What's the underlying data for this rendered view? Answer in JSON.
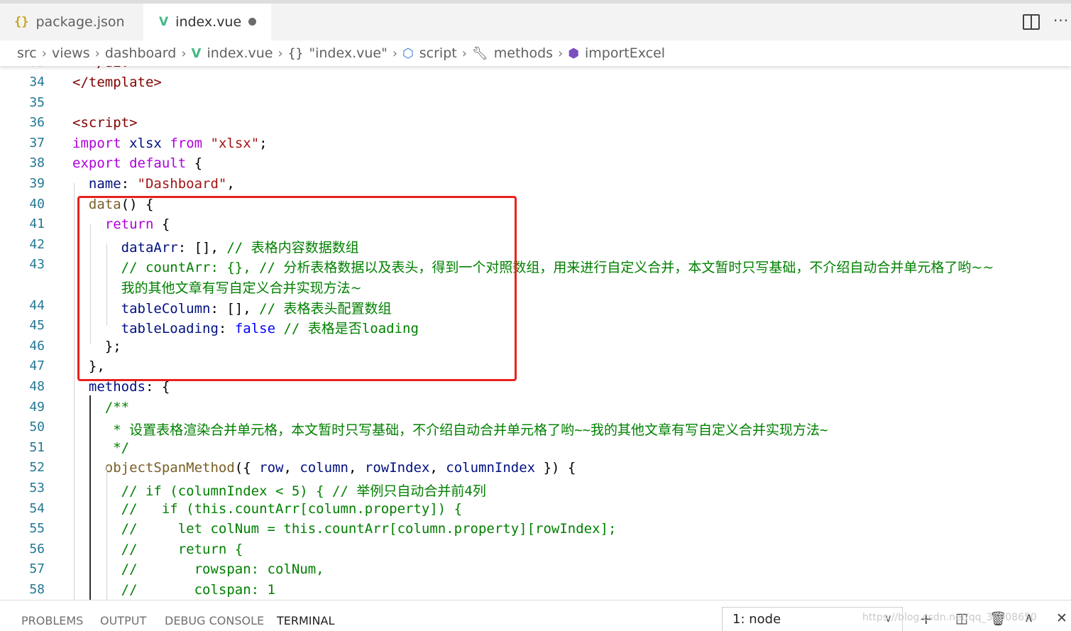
{
  "tabs": [
    {
      "label": "package.json",
      "icon": "json-braces-icon",
      "active": false
    },
    {
      "label": "index.vue",
      "icon": "vue-logo-icon",
      "active": true,
      "dirty": true
    }
  ],
  "breadcrumb": [
    "src",
    "views",
    "dashboard",
    "index.vue",
    "\"index.vue\"",
    "script",
    "methods",
    "importExcel"
  ],
  "editor": {
    "lines": [
      {
        "n": "34",
        "html": "<span class='t-tag'>&lt;/template&gt;</span>"
      },
      {
        "n": "35",
        "html": ""
      },
      {
        "n": "36",
        "html": "<span class='t-tag'>&lt;script&gt;</span>"
      },
      {
        "n": "37",
        "html": "<span class='t-kw'>import</span> <span class='t-prop'>xlsx</span> <span class='t-kw'>from</span> <span class='t-str'>\"xlsx\"</span>;"
      },
      {
        "n": "38",
        "html": "<span class='t-kw'>export</span> <span class='t-kw'>default</span> {"
      },
      {
        "n": "39",
        "html": "  <span class='t-prop'>name</span>: <span class='t-str'>\"Dashboard\"</span>,"
      },
      {
        "n": "40",
        "html": "  <span class='t-fn'>data</span>() {"
      },
      {
        "n": "41",
        "html": "    <span class='t-kw'>return</span> {"
      },
      {
        "n": "42",
        "html": "      <span class='t-prop'>dataArr</span>: [], <span class='t-cm'>// <span class='cjk'>表格内容数据数组</span></span>"
      },
      {
        "n": "43",
        "html": "      <span class='t-cm'>// countArr: {}, // <span class='cjk'>分析表格数据以及表头，得到一个对照数组，用来进行自定义合并，本文暂时只写基础，不介绍自动合并单元格了哟~~</span></span>"
      },
      {
        "n": "",
        "html": "      <span class='t-cm'><span class='cjk'>我的其他文章有写自定义合并实现方法~</span></span>"
      },
      {
        "n": "44",
        "html": "      <span class='t-prop'>tableColumn</span>: [], <span class='t-cm'>// <span class='cjk'>表格表头配置数组</span></span>"
      },
      {
        "n": "45",
        "html": "      <span class='t-prop'>tableLoading</span>: <span class='t-blue'>false</span> <span class='t-cm'>// <span class='cjk'>表格是否</span>loading</span>"
      },
      {
        "n": "46",
        "html": "    };"
      },
      {
        "n": "47",
        "html": "  },"
      },
      {
        "n": "48",
        "html": "  <span class='t-prop'>methods</span>: {"
      },
      {
        "n": "49",
        "html": "    <span class='t-cm'>/**</span>"
      },
      {
        "n": "50",
        "html": "     <span class='t-cm'>* <span class='cjk'>设置表格渲染合并单元格，本文暂时只写基础，不介绍自动合并单元格了哟</span>~~<span class='cjk'>我的其他文章有写自定义合并实现方法</span>~</span>"
      },
      {
        "n": "51",
        "html": "     <span class='t-cm'>*/</span>"
      },
      {
        "n": "52",
        "html": "    <span class='t-fn'>objectSpanMethod</span>({ <span class='t-par'>row</span>, <span class='t-par'>column</span>, <span class='t-par'>rowIndex</span>, <span class='t-par'>columnIndex</span> }) {"
      },
      {
        "n": "53",
        "html": "      <span class='t-cm'>// if (columnIndex &lt; 5) { // <span class='cjk'>举例只自动合并前</span>4<span class='cjk'>列</span></span>"
      },
      {
        "n": "54",
        "html": "      <span class='t-cm'>//   if (this.countArr[column.property]) {</span>"
      },
      {
        "n": "55",
        "html": "      <span class='t-cm'>//     let colNum = this.countArr[column.property][rowIndex];</span>"
      },
      {
        "n": "56",
        "html": "      <span class='t-cm'>//     return {</span>"
      },
      {
        "n": "57",
        "html": "      <span class='t-cm'>//       rowspan: colNum,</span>"
      },
      {
        "n": "58",
        "html": "      <span class='t-cm'>//       colspan: 1</span>"
      }
    ]
  },
  "panel": {
    "tabs": [
      "PROBLEMS",
      "OUTPUT",
      "DEBUG CONSOLE",
      "TERMINAL"
    ],
    "active_tab": "TERMINAL",
    "terminal_select": "1: node",
    "watermark": "https://blog.csdn.net/qq_36908650"
  }
}
